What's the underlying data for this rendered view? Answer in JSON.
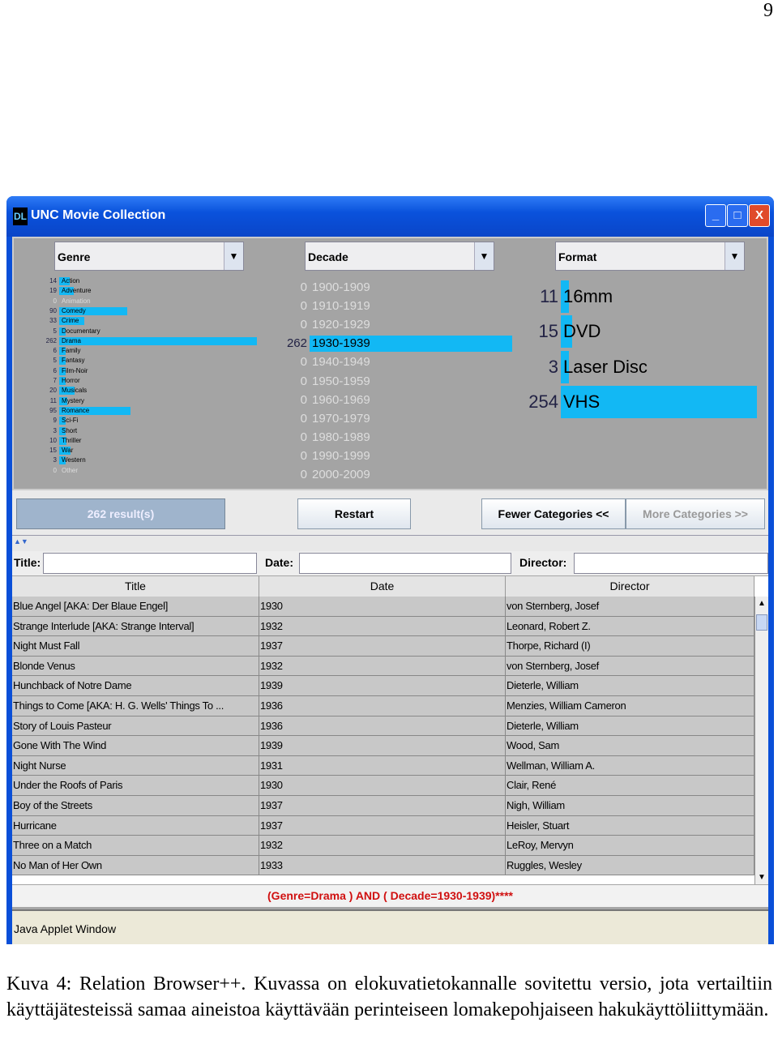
{
  "page_number": "9",
  "window": {
    "logo": "DL",
    "title": "UNC Movie Collection",
    "controls": [
      "_",
      "□",
      "X"
    ]
  },
  "facets": {
    "genre": {
      "label": "Genre",
      "items": [
        {
          "label": "Action",
          "count": 14
        },
        {
          "label": "Adventure",
          "count": 19
        },
        {
          "label": "Animation",
          "count": 0
        },
        {
          "label": "Comedy",
          "count": 90
        },
        {
          "label": "Crime",
          "count": 33
        },
        {
          "label": "Documentary",
          "count": 5
        },
        {
          "label": "Drama",
          "count": 262
        },
        {
          "label": "Family",
          "count": 6
        },
        {
          "label": "Fantasy",
          "count": 5
        },
        {
          "label": "Film-Noir",
          "count": 6
        },
        {
          "label": "Horror",
          "count": 7
        },
        {
          "label": "Musicals",
          "count": 20
        },
        {
          "label": "Mystery",
          "count": 11
        },
        {
          "label": "Romance",
          "count": 95
        },
        {
          "label": "Sci-Fi",
          "count": 9
        },
        {
          "label": "Short",
          "count": 3
        },
        {
          "label": "Thriller",
          "count": 10
        },
        {
          "label": "War",
          "count": 15
        },
        {
          "label": "Western",
          "count": 3
        },
        {
          "label": "Other",
          "count": 0
        }
      ]
    },
    "decade": {
      "label": "Decade",
      "items": [
        {
          "label": "1900-1909",
          "count": 0
        },
        {
          "label": "1910-1919",
          "count": 0
        },
        {
          "label": "1920-1929",
          "count": 0
        },
        {
          "label": "1930-1939",
          "count": 262
        },
        {
          "label": "1940-1949",
          "count": 0
        },
        {
          "label": "1950-1959",
          "count": 0
        },
        {
          "label": "1960-1969",
          "count": 0
        },
        {
          "label": "1970-1979",
          "count": 0
        },
        {
          "label": "1980-1989",
          "count": 0
        },
        {
          "label": "1990-1999",
          "count": 0
        },
        {
          "label": "2000-2009",
          "count": 0
        }
      ]
    },
    "format": {
      "label": "Format",
      "items": [
        {
          "label": "16mm",
          "count": 11
        },
        {
          "label": "DVD",
          "count": 15
        },
        {
          "label": "Laser Disc",
          "count": 3
        },
        {
          "label": "VHS",
          "count": 254
        }
      ]
    },
    "bar_color": "#12b8f4"
  },
  "buttons": {
    "results": "262 result(s)",
    "restart": "Restart",
    "fewer": "Fewer Categories <<",
    "more": "More Categories >>"
  },
  "search": {
    "title_label": "Title:",
    "date_label": "Date:",
    "director_label": "Director:",
    "title_value": "",
    "date_value": "",
    "director_value": ""
  },
  "table": {
    "headers": [
      "Title",
      "Date",
      "Director"
    ],
    "rows": [
      [
        "Blue Angel [AKA: Der Blaue Engel]",
        "1930",
        "von Sternberg, Josef"
      ],
      [
        "Strange Interlude [AKA: Strange Interval]",
        "1932",
        "Leonard, Robert Z."
      ],
      [
        "Night Must Fall",
        "1937",
        "Thorpe, Richard (I)"
      ],
      [
        "Blonde Venus",
        "1932",
        "von Sternberg, Josef"
      ],
      [
        "Hunchback of Notre Dame",
        "1939",
        "Dieterle, William"
      ],
      [
        "Things to Come [AKA: H. G. Wells' Things To ...",
        "1936",
        "Menzies, William Cameron"
      ],
      [
        "Story of Louis Pasteur",
        "1936",
        "Dieterle, William"
      ],
      [
        "Gone With The Wind",
        "1939",
        "Wood, Sam"
      ],
      [
        "Night Nurse",
        "1931",
        "Wellman, William A."
      ],
      [
        "Under the Roofs of Paris",
        "1930",
        "Clair, René"
      ],
      [
        "Boy of the Streets",
        "1937",
        "Nigh, William"
      ],
      [
        "Hurricane",
        "1937",
        "Heisler, Stuart"
      ],
      [
        "Three on a Match",
        "1932",
        "LeRoy, Mervyn"
      ],
      [
        "No Man of Her Own",
        "1933",
        "Ruggles, Wesley"
      ]
    ]
  },
  "query": "(Genre=Drama ) AND ( Decade=1930-1939)****",
  "status": "Java Applet Window",
  "caption": "Kuva 4: Relation Browser++. Kuvassa on elokuvatietokannalle sovitettu versio, jota vertailtiin käyttäjätesteissä samaa aineistoa käyttävään perinteiseen lomakepohjaiseen hakukäyttöliittymään."
}
